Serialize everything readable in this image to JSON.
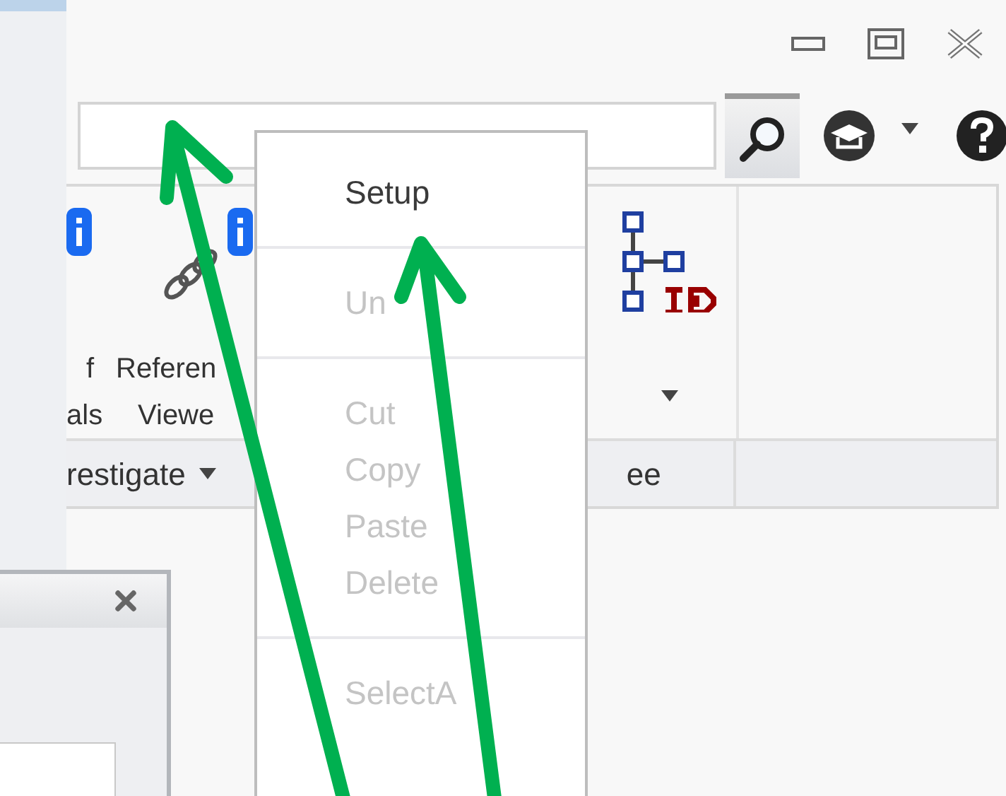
{
  "ribbon": {
    "buttons": [
      {
        "lines": [
          "f",
          "als"
        ],
        "badge": true
      },
      {
        "lines": [
          "Referen",
          "Viewe"
        ],
        "badge": true
      }
    ],
    "groups": [
      {
        "label": "restigate",
        "has_menu": true
      },
      {
        "label": "ee",
        "has_menu": false
      }
    ]
  },
  "context_menu": {
    "items": [
      {
        "kind": "item",
        "label": "Setup",
        "disabled": false
      },
      {
        "kind": "separator"
      },
      {
        "kind": "item",
        "label": "Un",
        "disabled": true
      },
      {
        "kind": "separator"
      },
      {
        "kind": "item",
        "label": "Cut",
        "disabled": true
      },
      {
        "kind": "item",
        "label": "Copy",
        "disabled": true
      },
      {
        "kind": "item",
        "label": "Paste",
        "disabled": true
      },
      {
        "kind": "item",
        "label": "Delete",
        "disabled": true
      },
      {
        "kind": "separator"
      },
      {
        "kind": "item",
        "label": "SelectA",
        "disabled": true
      }
    ]
  }
}
